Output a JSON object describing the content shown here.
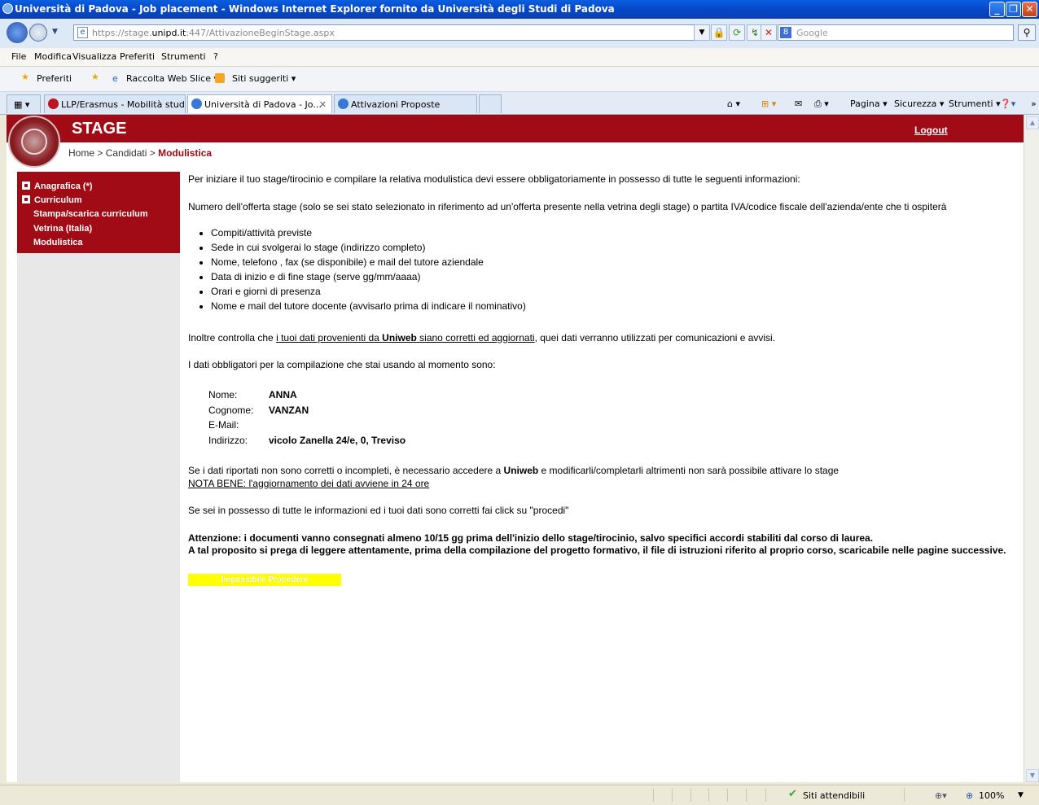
{
  "window": {
    "title": "Università di Padova - Job placement - Windows Internet Explorer fornito da Università degli Studi di Padova"
  },
  "address": {
    "url_prefix": "https://stage.",
    "url_domain": "unipd.it",
    "url_rest": ":447/AttivazioneBeginStage.aspx",
    "search_placeholder": "Google"
  },
  "menu": [
    "File",
    "Modifica",
    "Visualizza",
    "Preferiti",
    "Strumenti",
    "?"
  ],
  "favorites": {
    "preferiti": "Preferiti",
    "raccolta": "Raccolta Web Slice ▾",
    "siti": "Siti suggeriti ▾"
  },
  "tabs": [
    {
      "label": "LLP/Erasmus - Mobilità stude..."
    },
    {
      "label": "Università di Padova - Jo..."
    },
    {
      "label": "Attivazioni Proposte"
    }
  ],
  "commandbar": {
    "pagina": "Pagina ▾",
    "sicurezza": "Sicurezza ▾",
    "strumenti": "Strumenti ▾"
  },
  "page": {
    "title": "STAGE",
    "logout": "Logout",
    "breadcrumb": {
      "home": "Home",
      "sep1": " > ",
      "candidati": "Candidati",
      "sep2": " > ",
      "current": "Modulistica"
    },
    "sidebar": [
      {
        "label": "Anagrafica (*)"
      },
      {
        "label": "Curriculum"
      },
      {
        "label": "Stampa/scarica curriculum"
      },
      {
        "label": "Vetrina (Italia)"
      },
      {
        "label": "Modulistica"
      }
    ],
    "intro": "Per iniziare il tuo stage/tirocinio e compilare la relativa modulistica devi essere obbligatoriamente in possesso di tutte le seguenti informazioni:",
    "numero_offerta": "Numero dell'offerta stage (solo se sei stato selezionato in riferimento ad un'offerta presente nella vetrina degli stage) o partita IVA/codice fiscale dell'azienda/ente che ti ospiterà",
    "requirements": [
      "Compiti/attività previste",
      "Sede in cui svolgerai lo stage (indirizzo completo)",
      "Nome, telefono , fax (se disponibile) e mail del tutore aziendale",
      "Data di inizio e di fine stage (serve gg/mm/aaaa)",
      "Orari e giorni di presenza",
      "Nome e mail del tutore docente (avvisarlo prima di indicare il nominativo)"
    ],
    "inoltre_pre": "Inoltre controlla che ",
    "inoltre_link_a": "i tuoi dati provenienti da ",
    "inoltre_link_b": "Uniweb",
    "inoltre_link_c": " siano corretti ed aggiornati",
    "inoltre_post": ", quei dati verranno utilizzati per comunicazioni e avvisi.",
    "dati_intro": "I dati obbligatori per la compilazione che stai usando al momento sono:",
    "fields": {
      "nome_label": "Nome:",
      "nome_value": "ANNA",
      "cognome_label": "Cognome:",
      "cognome_value": "VANZAN",
      "email_label": "E-Mail:",
      "email_value": "",
      "indirizzo_label": "Indirizzo:",
      "indirizzo_value": "vicolo Zanella 24/e, 0, Treviso"
    },
    "se_dati_pre": "Se i dati riportati non sono corretti o incompleti, è necessario accedere a ",
    "se_dati_bold": "Uniweb",
    "se_dati_post": " e modificarli/completarli altrimenti non sarà possibile attivare lo stage",
    "nota_bene": "NOTA BENE: l'aggiornamento dei dati avviene in 24 ore",
    "procedi_text": "Se sei in possesso di tutte le informazioni ed i tuoi dati sono corretti fai click su \"procedi\"",
    "attenzione_1": "Attenzione: i documenti vanno consegnati almeno 10/15 gg prima dell'inizio dello stage/tirocinio, salvo specifici accordi stabiliti dal corso di laurea.",
    "attenzione_2": "A tal proposito si prega di leggere attentamente, prima della compilazione del progetto formativo, il file di istruzioni riferito al proprio corso, scaricabile nelle pagine successive.",
    "button": "Impossibile Procedere"
  },
  "status": {
    "zone": "Siti attendibili",
    "zoom": "100%"
  }
}
